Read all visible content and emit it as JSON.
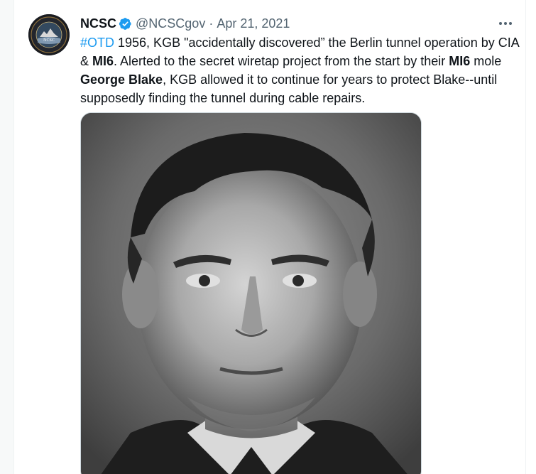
{
  "tweet": {
    "display_name": "NCSC",
    "handle": "@NCSCgov",
    "separator": "·",
    "date": "Apr 21, 2021",
    "text": {
      "hashtag": "#OTD",
      "part1": " 1956, KGB \"accidentally discovered” the Berlin tunnel operation by CIA & ",
      "mi6_a": "MI6",
      "part2": ". Alerted to the secret wiretap project from the start by their ",
      "mi6_b": "MI6",
      "part3": " mole ",
      "name_bold": "George Blake",
      "part4": ", KGB allowed it to continue for years to protect Blake--until supposedly finding the tunnel during cable repairs."
    },
    "avatar_text": "NCSC",
    "icons": {
      "verified": "verified-badge-icon",
      "more": "more-options-icon"
    },
    "colors": {
      "link": "#1d9bf0",
      "text": "#0f1419",
      "secondary": "#536471"
    }
  }
}
